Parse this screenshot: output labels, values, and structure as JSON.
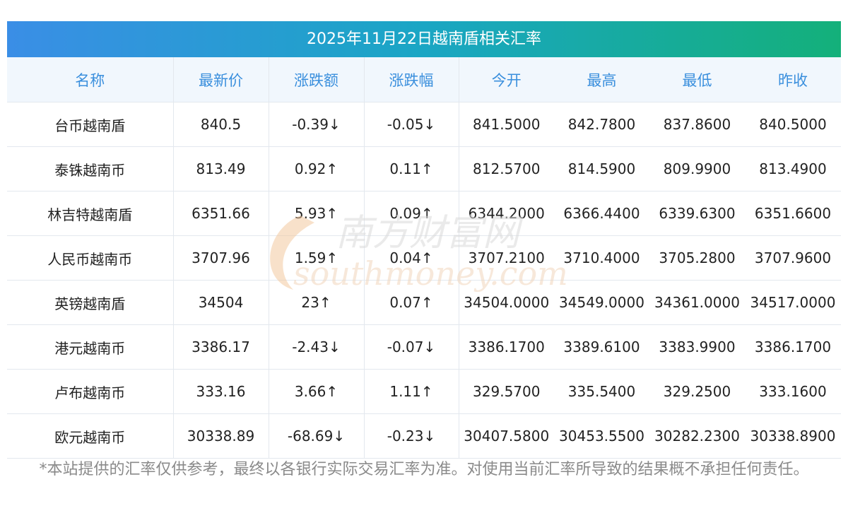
{
  "title": "2025年11月22日越南盾相关汇率",
  "headers": [
    "名称",
    "最新价",
    "涨跌额",
    "涨跌幅",
    "今开",
    "最高",
    "最低",
    "昨收"
  ],
  "rows": [
    {
      "name": "台币越南盾",
      "latest": "840.5",
      "change": "-0.39↓",
      "pct": "-0.05↓",
      "open": "841.5000",
      "high": "842.7800",
      "low": "837.8600",
      "prev": "840.5000",
      "trend": "down"
    },
    {
      "name": "泰铢越南币",
      "latest": "813.49",
      "change": "0.92↑",
      "pct": "0.11↑",
      "open": "812.5700",
      "high": "814.5900",
      "low": "809.9900",
      "prev": "813.4900",
      "trend": "up"
    },
    {
      "name": "林吉特越南盾",
      "latest": "6351.66",
      "change": "5.93↑",
      "pct": "0.09↑",
      "open": "6344.2000",
      "high": "6366.4400",
      "low": "6339.6300",
      "prev": "6351.6600",
      "trend": "up"
    },
    {
      "name": "人民币越南币",
      "latest": "3707.96",
      "change": "1.59↑",
      "pct": "0.04↑",
      "open": "3707.2100",
      "high": "3710.4000",
      "low": "3705.2800",
      "prev": "3707.9600",
      "trend": "up"
    },
    {
      "name": "英镑越南盾",
      "latest": "34504",
      "change": "23↑",
      "pct": "0.07↑",
      "open": "34504.0000",
      "high": "34549.0000",
      "low": "34361.0000",
      "prev": "34517.0000",
      "trend": "up"
    },
    {
      "name": "港元越南币",
      "latest": "3386.17",
      "change": "-2.43↓",
      "pct": "-0.07↓",
      "open": "3386.1700",
      "high": "3389.6100",
      "low": "3383.9900",
      "prev": "3386.1700",
      "trend": "down"
    },
    {
      "name": "卢布越南币",
      "latest": "333.16",
      "change": "3.66↑",
      "pct": "1.11↑",
      "open": "329.5700",
      "high": "335.5400",
      "low": "329.2500",
      "prev": "333.1600",
      "trend": "up"
    },
    {
      "name": "欧元越南币",
      "latest": "30338.89",
      "change": "-68.69↓",
      "pct": "-0.23↓",
      "open": "30407.5800",
      "high": "30453.5500",
      "low": "30282.2300",
      "prev": "30338.8900",
      "trend": "down"
    }
  ],
  "watermark": {
    "cn": "南方财富网",
    "en": "southmoney.com"
  },
  "disclaimer": "*本站提供的汇率仅供参考，最终以各银行实际交易汇率为准。对使用当前汇率所导致的结果概不承担任何责任。",
  "colors": {
    "up": "#e4161c",
    "down": "#1a8a1a",
    "header_text": "#3a8fdd",
    "header_bg": "#f1f7fd"
  }
}
